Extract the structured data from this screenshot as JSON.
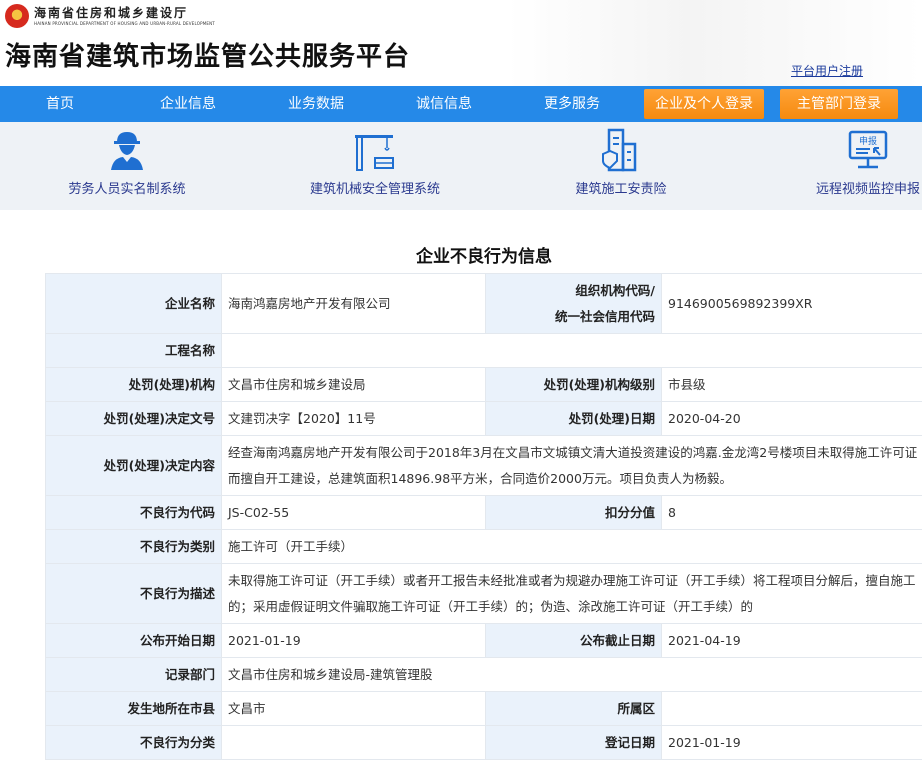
{
  "header": {
    "department_cn": "海南省住房和城乡建设厅",
    "department_en": "HAINAN PROVINCIAL DEPARTMENT OF HOUSING AND URBAN-RURAL DEVELOPMENT",
    "site_title": "海南省建筑市场监管公共服务平台",
    "register_link": "平台用户注册"
  },
  "nav": {
    "items": [
      "首页",
      "企业信息",
      "业务数据",
      "诚信信息",
      "更多服务"
    ],
    "login_enterprise": "企业及个人登录",
    "login_dept": "主管部门登录",
    "accent_color": "#2589e8",
    "button_color": "#f58a0f"
  },
  "quicklinks": [
    {
      "label": "劳务人员实名制系统",
      "icon": "worker-icon"
    },
    {
      "label": "建筑机械安全管理系统",
      "icon": "crane-icon"
    },
    {
      "label": "建筑施工安责险",
      "icon": "insured-building-icon"
    },
    {
      "label": "远程视频监控申报",
      "icon": "report-monitor-icon"
    }
  ],
  "page_title": "企业不良行为信息",
  "record": {
    "company_name_label": "企业名称",
    "company_name": "海南鸿嘉房地产开发有限公司",
    "credit_code_label_1": "组织机构代码/",
    "credit_code_label_2": "统一社会信用代码",
    "credit_code": "9146900569892399XR",
    "project_name_label": "工程名称",
    "project_name": "",
    "authority_label": "处罚(处理)机构",
    "authority": "文昌市住房和城乡建设局",
    "authority_level_label": "处罚(处理)机构级别",
    "authority_level": "市县级",
    "decision_no_label": "处罚(处理)决定文号",
    "decision_no": "文建罚决字【2020】11号",
    "decision_date_label": "处罚(处理)日期",
    "decision_date": "2020-04-20",
    "decision_content_label": "处罚(处理)决定内容",
    "decision_content": "经查海南鸿嘉房地产开发有限公司于2018年3月在文昌市文城镇文清大道投资建设的鸿嘉.金龙湾2号楼项目未取得施工许可证而擅自开工建设，总建筑面积14896.98平方米，合同造价2000万元。项目负责人为杨毅。",
    "behavior_code_label": "不良行为代码",
    "behavior_code": "JS-C02-55",
    "deduction_label": "扣分分值",
    "deduction": "8",
    "behavior_category_label": "不良行为类别",
    "behavior_category": "施工许可（开工手续）",
    "behavior_desc_label": "不良行为描述",
    "behavior_desc": "未取得施工许可证（开工手续）或者开工报告未经批准或者为规避办理施工许可证（开工手续）将工程项目分解后，擅自施工的；采用虚假证明文件骗取施工许可证（开工手续）的；伪造、涂改施工许可证（开工手续）的",
    "publish_start_label": "公布开始日期",
    "publish_start": "2021-01-19",
    "publish_end_label": "公布截止日期",
    "publish_end": "2021-04-19",
    "record_dept_label": "记录部门",
    "record_dept": "文昌市住房和城乡建设局-建筑管理股",
    "location_city_label": "发生地所在市县",
    "location_city": "文昌市",
    "district_label": "所属区",
    "district": "",
    "behavior_class_label": "不良行为分类",
    "behavior_class": "",
    "register_date_label": "登记日期",
    "register_date": "2021-01-19"
  }
}
